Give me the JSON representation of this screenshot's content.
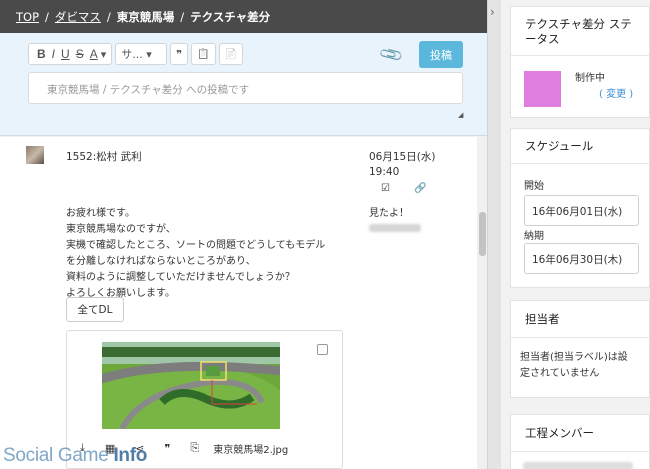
{
  "breadcrumb": {
    "top": "TOP",
    "sep": "/",
    "project": "ダビマス",
    "area": "東京競馬場",
    "task": "テクスチャ差分"
  },
  "toolbar": {
    "bold": "B",
    "italic": "I",
    "underline": "U",
    "strike": "S",
    "color": "A",
    "size": "サ...",
    "quote": "❞",
    "paste": "📋",
    "file": "📄"
  },
  "composer": {
    "post_label": "投稿",
    "placeholder": "東京競馬場 / テクスチャ差分 への投稿です"
  },
  "post": {
    "author": "1552:松村 武利",
    "date": "06月15日(水)",
    "time": "19:40",
    "lines": [
      "お疲れ様です。",
      "東京競馬場なのですが、",
      "実機で確認したところ、ソートの問題でどうしてもモデル",
      "を分離しなければならないところがあり、",
      "資料のように調整していただけませんでしょうか？",
      "よろしくお願いします。"
    ],
    "reply": "見たよ！",
    "download_all": "全てDL",
    "attachment_name": "東京競馬場2.jpg"
  },
  "watermark": {
    "part1": "Social Game ",
    "part2": "Info"
  },
  "sidebar": {
    "status_title_1": "テクスチャ差分 ステ",
    "status_title_2": "ータス",
    "status_color": "#e07ee0",
    "status_text": "制作中",
    "change_link": "( 変更 )",
    "schedule_title": "スケジュール",
    "start_label": "開始",
    "start_value": "16年06月01日(水)",
    "due_label": "納期",
    "due_value": "16年06月30日(木)",
    "assignee_title": "担当者",
    "assignee_line1": "担当者(担当ラベル)は設",
    "assignee_line2": "定されていません",
    "members_title": "工程メンバー"
  }
}
